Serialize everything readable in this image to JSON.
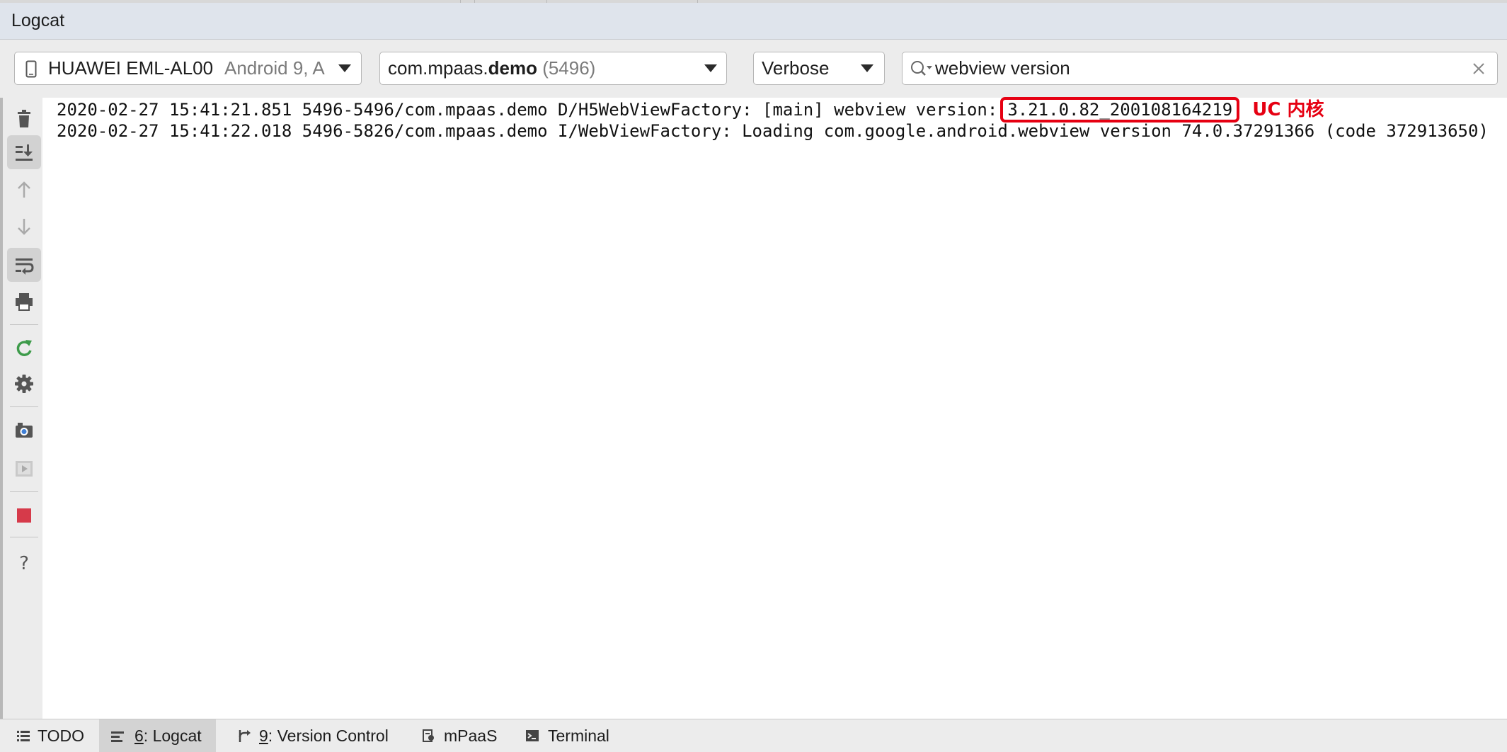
{
  "window": {
    "title": "Logcat"
  },
  "toolbar": {
    "device": {
      "name": "HUAWEI EML-AL00",
      "detail": "Android 9, A"
    },
    "process": {
      "prefix": "com.mpaas.",
      "bold": "demo",
      "pid": "(5496)"
    },
    "log_level": "Verbose",
    "search": {
      "value": "webview version",
      "icon": "search-icon"
    }
  },
  "left_tools": [
    {
      "name": "clear-logcat-icon",
      "active": false
    },
    {
      "name": "scroll-to-end-icon",
      "active": true
    },
    {
      "name": "up-arrow-icon",
      "active": false
    },
    {
      "name": "down-arrow-icon",
      "active": false
    },
    {
      "name": "soft-wrap-icon",
      "active": true
    },
    {
      "name": "print-icon",
      "active": false
    },
    {
      "name": "restart-icon",
      "active": false
    },
    {
      "name": "gear-icon",
      "active": false
    },
    {
      "name": "screen-capture-icon",
      "active": false
    },
    {
      "name": "screen-record-icon",
      "active": false
    },
    {
      "name": "stop-icon",
      "active": false
    },
    {
      "name": "help-icon",
      "active": false
    }
  ],
  "log": {
    "lines": [
      {
        "text": "2020-02-27 15:41:21.851 5496-5496/com.mpaas.demo D/H5WebViewFactory: [main] webview version:",
        "highlight": "3.21.0.82_200108164219",
        "annotation": "UC 内核"
      },
      {
        "text": "2020-02-27 15:41:22.018 5496-5826/com.mpaas.demo I/WebViewFactory: Loading com.google.android.webview version 74.0.37291366 (code 372913650)"
      }
    ]
  },
  "bottom_tabs": [
    {
      "label": "TODO",
      "mnemonic": "",
      "icon": "list-icon",
      "active": false
    },
    {
      "label": ": Logcat",
      "mnemonic": "6",
      "icon": "logcat-icon",
      "active": true
    },
    {
      "label": ": Version Control",
      "mnemonic": "9",
      "icon": "version-control-icon",
      "active": false
    },
    {
      "label": "mPaaS",
      "mnemonic": "",
      "icon": "mpaas-icon",
      "active": false
    },
    {
      "label": "Terminal",
      "mnemonic": "",
      "icon": "terminal-icon",
      "active": false
    }
  ],
  "colors": {
    "highlight": "#e60012",
    "run": "#3d9b4a",
    "stop": "#d63a4a"
  }
}
